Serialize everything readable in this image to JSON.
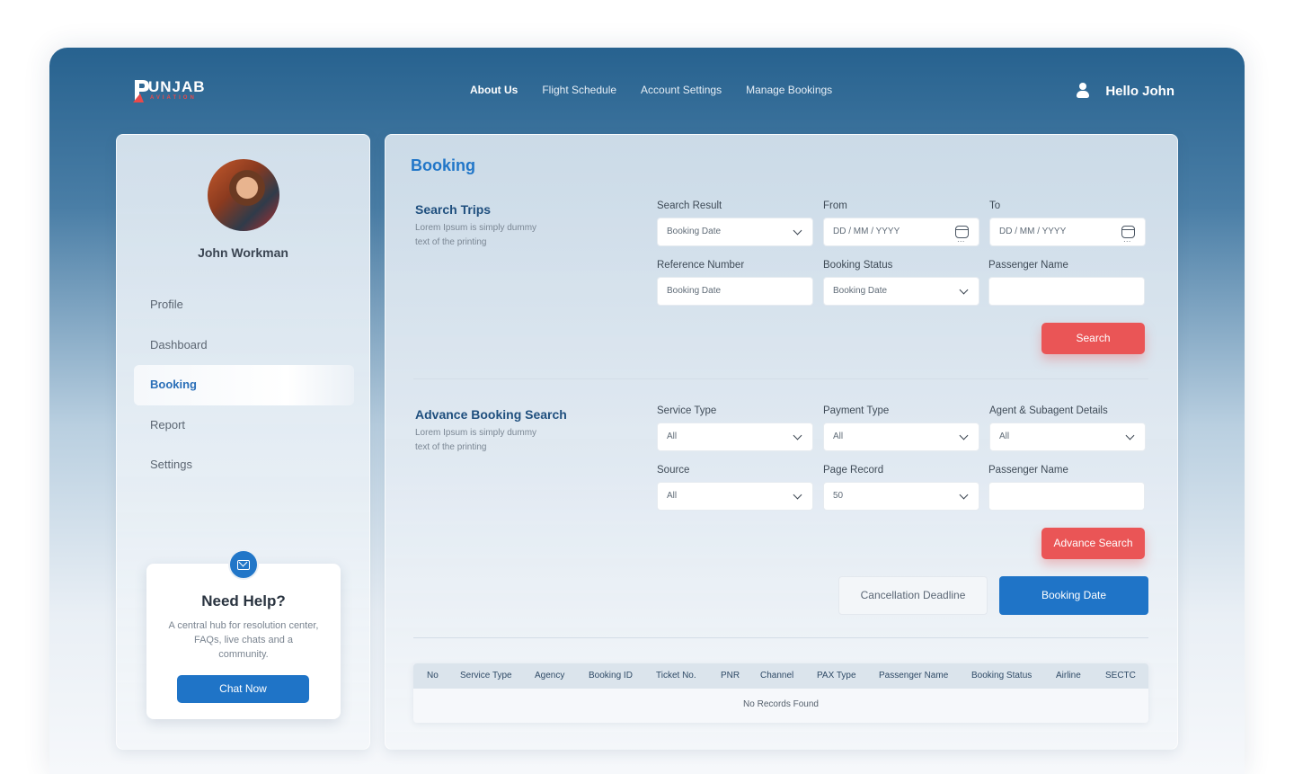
{
  "brand": {
    "name": "UNJAB",
    "sub": "AVIATION",
    "logo_icon": "p-plane-logo-icon"
  },
  "nav": [
    {
      "label": "About Us",
      "active": true
    },
    {
      "label": "Flight Schedule",
      "active": false
    },
    {
      "label": "Account Settings",
      "active": false
    },
    {
      "label": "Manage Bookings",
      "active": false
    }
  ],
  "user": {
    "greeting": "Hello John",
    "icon": "user-icon"
  },
  "sidebar": {
    "profile_name": "John Workman",
    "items": [
      {
        "label": "Profile",
        "active": false
      },
      {
        "label": "Dashboard",
        "active": false
      },
      {
        "label": "Booking",
        "active": true
      },
      {
        "label": "Report",
        "active": false
      },
      {
        "label": "Settings",
        "active": false
      }
    ],
    "help": {
      "icon": "mail-icon",
      "title": "Need Help?",
      "text": "A central hub for resolution center, FAQs, live chats and a community.",
      "button": "Chat Now"
    }
  },
  "main": {
    "title": "Booking",
    "search_trips": {
      "title": "Search Trips",
      "desc": "Lorem Ipsum is simply dummy text of the printing",
      "fields": {
        "search_result": {
          "label": "Search Result",
          "value": "Booking Date"
        },
        "from": {
          "label": "From",
          "value": "DD / MM / YYYY"
        },
        "to": {
          "label": "To",
          "value": "DD / MM / YYYY"
        },
        "reference_number": {
          "label": "Reference Number",
          "value": "Booking Date"
        },
        "booking_status": {
          "label": "Booking Status",
          "value": "Booking Date"
        },
        "passenger_name": {
          "label": "Passenger Name",
          "value": ""
        }
      },
      "button": "Search"
    },
    "advance_search": {
      "title": "Advance Booking Search",
      "desc": "Lorem Ipsum is simply dummy text of the printing",
      "fields": {
        "service_type": {
          "label": "Service Type",
          "value": "All"
        },
        "payment_type": {
          "label": "Payment Type",
          "value": "All"
        },
        "agent": {
          "label": "Agent & Subagent Details",
          "value": "All"
        },
        "source": {
          "label": "Source",
          "value": "All"
        },
        "page_record": {
          "label": "Page Record",
          "value": "50"
        },
        "passenger_name": {
          "label": "Passenger Name",
          "value": ""
        }
      },
      "button": "Advance Search"
    },
    "tabs": {
      "cancellation": "Cancellation Deadline",
      "booking_date": "Booking Date"
    },
    "table": {
      "columns": [
        "No",
        "Service Type",
        "Agency",
        "Booking ID",
        "Ticket No.",
        "PNR",
        "Channel",
        "PAX Type",
        "Passenger Name",
        "Booking Status",
        "Airline",
        "SECTC"
      ],
      "empty": "No Records Found"
    }
  },
  "colors": {
    "primary": "#1f74c7",
    "accent_red": "#ea5556",
    "header_top": "#27628f"
  }
}
